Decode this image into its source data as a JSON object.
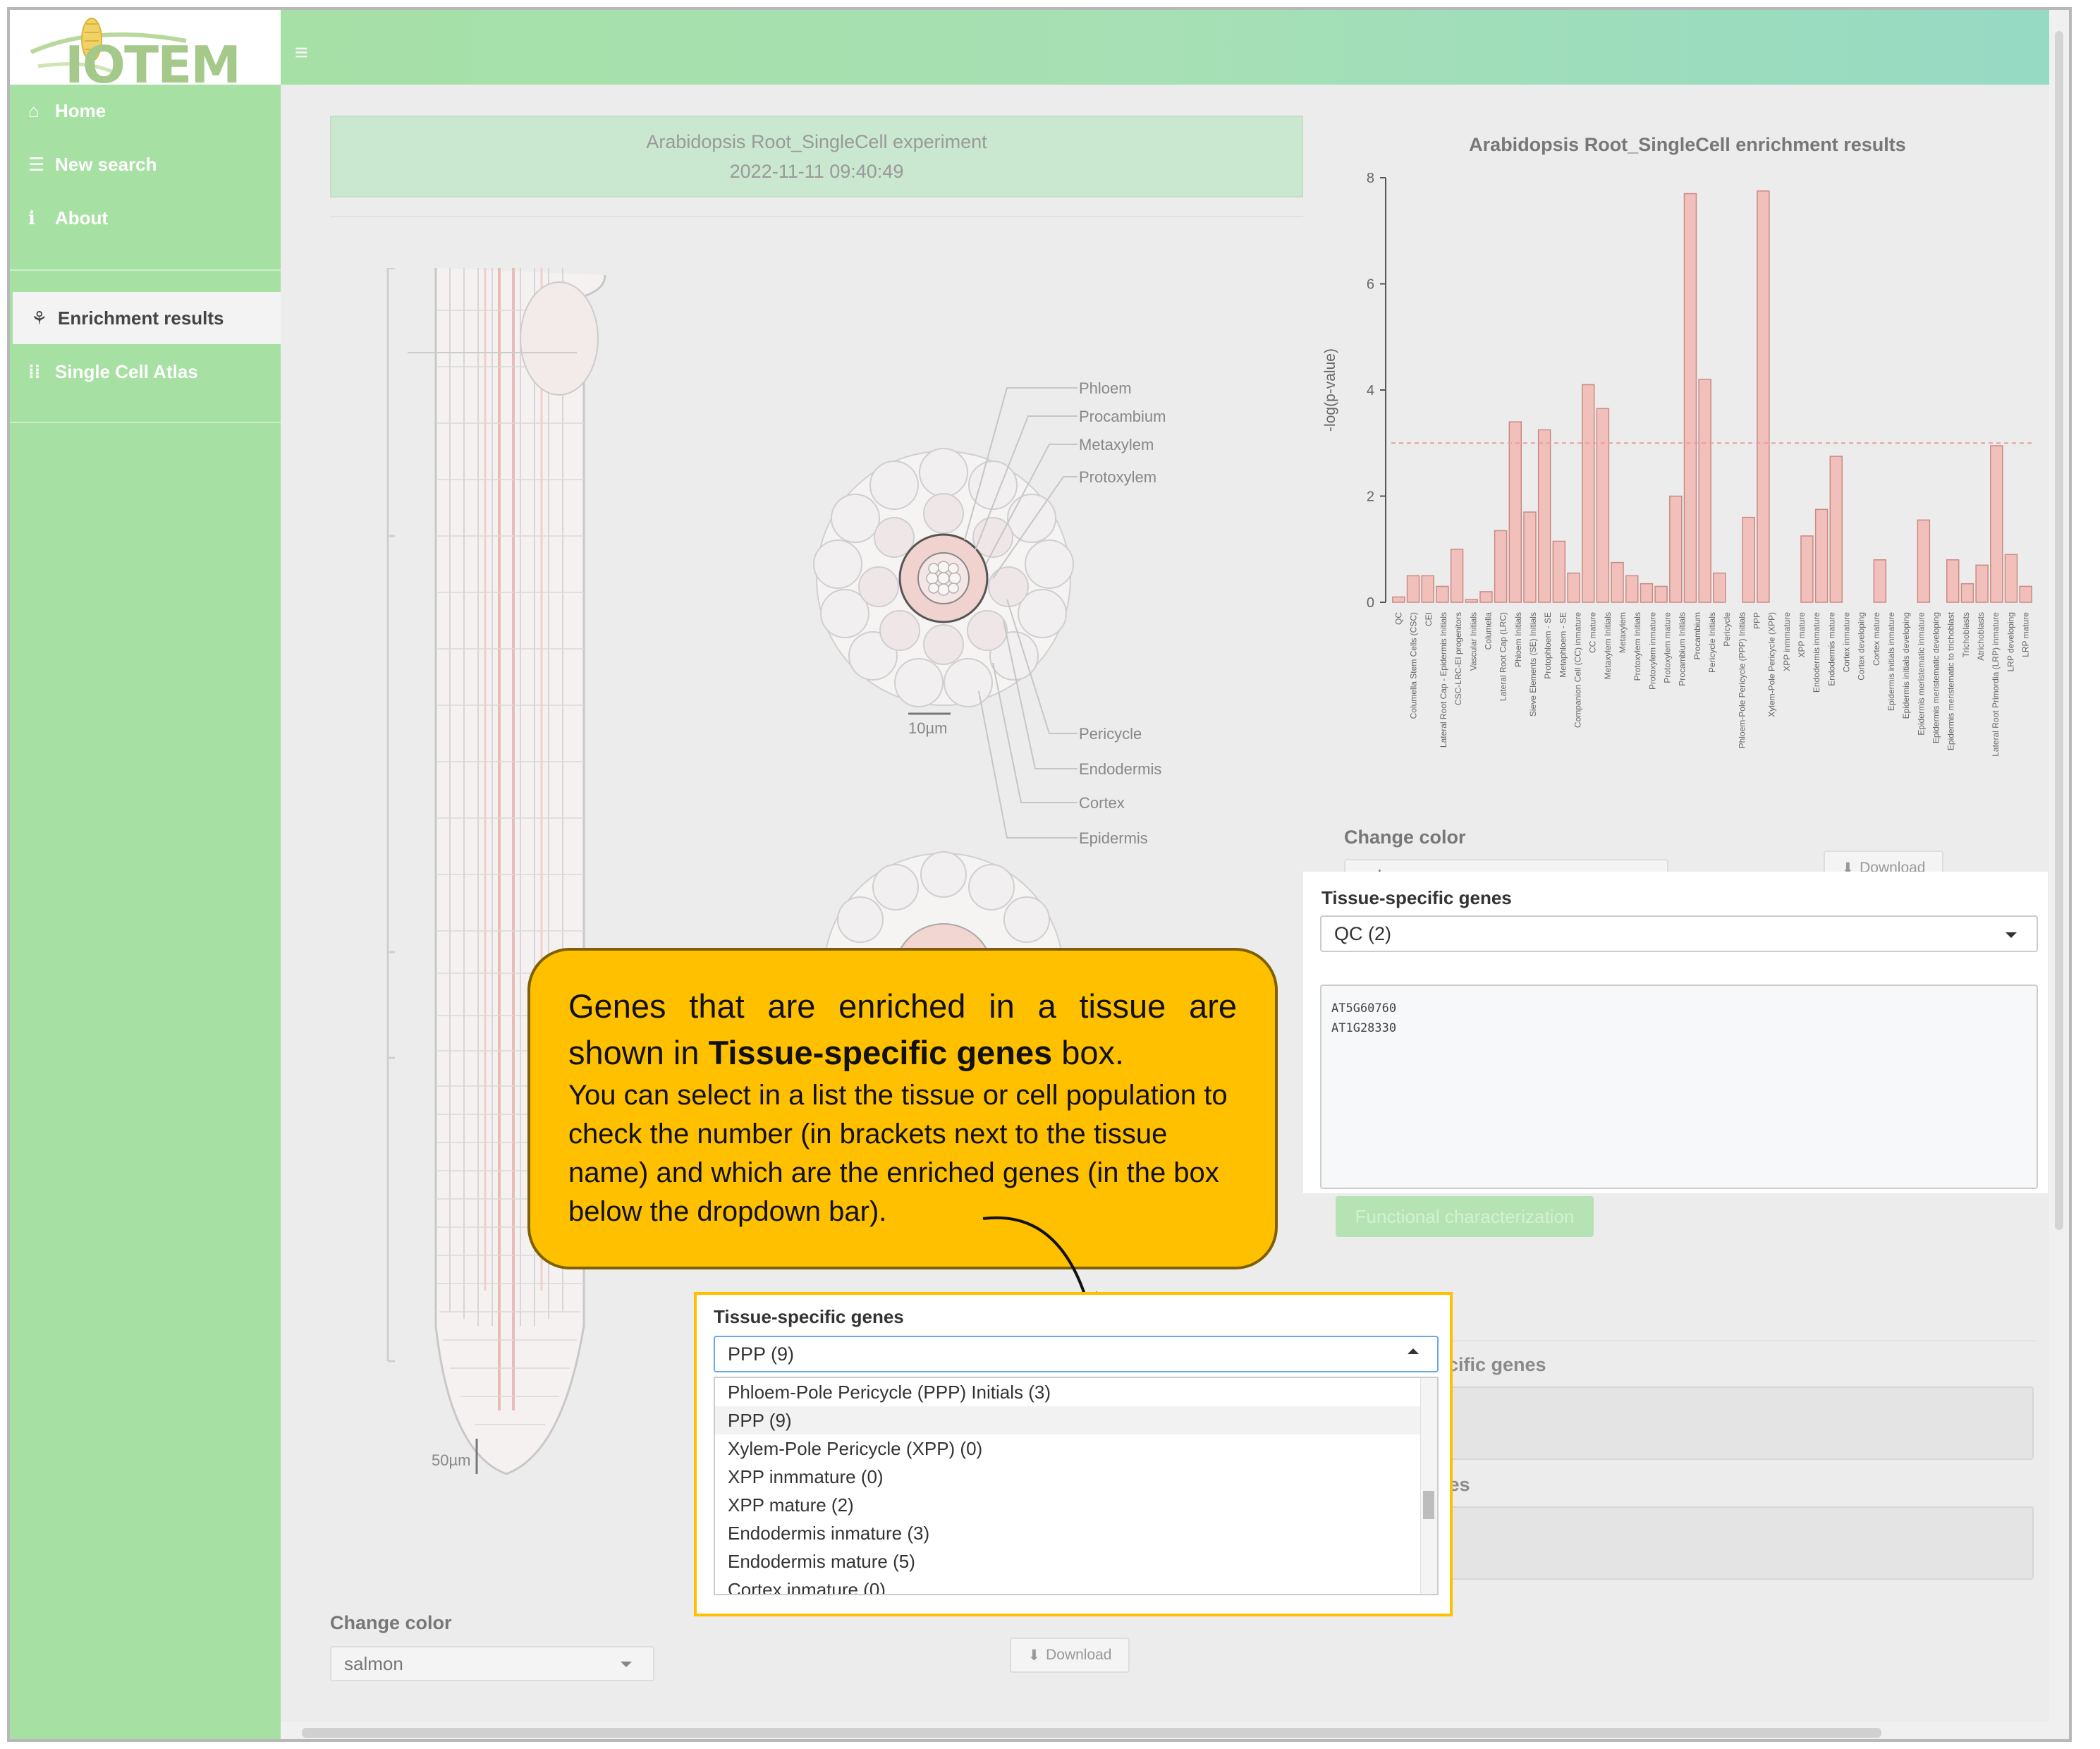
{
  "app": {
    "logo_text": "IOTEM",
    "menu_icon": "hamburger-icon"
  },
  "sidebar": {
    "items": [
      {
        "label": "Home",
        "icon": "home-icon"
      },
      {
        "label": "New search",
        "icon": "database-icon"
      },
      {
        "label": "About",
        "icon": "info-icon"
      },
      {
        "label": "Enrichment results",
        "icon": "seedling-icon"
      },
      {
        "label": "Single Cell Atlas",
        "icon": "grid-dots-icon"
      }
    ]
  },
  "experiment": {
    "name": "Arabidopsis Root_SingleCell experiment",
    "timestamp": "2022-11-11 09:40:49"
  },
  "diagram": {
    "labels_top": [
      "Phloem",
      "Procambium",
      "Metaxylem",
      "Protoxylem"
    ],
    "labels_bottom": [
      "Pericycle",
      "Endodermis",
      "Cortex",
      "Epidermis"
    ],
    "scale_small": "10µm",
    "scale_large": "50µm",
    "highlight_color": "#f2c6bf"
  },
  "left_controls": {
    "change_color_label": "Change color",
    "color_value": "salmon",
    "download_label": "Download"
  },
  "chart_data": {
    "type": "bar",
    "title": "Arabidopsis Root_SingleCell enrichment results",
    "ylabel": "-log(p-value)",
    "xlabel": "",
    "ylim": [
      0,
      8
    ],
    "yticks": [
      0,
      2,
      4,
      6,
      8
    ],
    "threshold": 3,
    "bar_color": "#f2c0bb",
    "bar_border": "#c98a84",
    "threshold_color": "#e8a0a0",
    "categories": [
      "QC",
      "Columella Stem Cells (CSC)",
      "CEI",
      "Lateral Root Cap - Epidermis Initials",
      "CSC-LRC-EI progenitors",
      "Vascular Initials",
      "Columella",
      "Lateral Root Cap (LRC)",
      "Phloem Initials",
      "Sieve Elements (SE) Initials",
      "Protophloem - SE",
      "Metaphloem - SE",
      "Companion Cell (CC) inmature",
      "CC mature",
      "Metaxylem Initials",
      "Metaxylem",
      "Protoxylem Initials",
      "Protoxylem inmature",
      "Protoxylem mature",
      "Procambium Initials",
      "Procambium",
      "Pericycle Initials",
      "Pericycle",
      "Phloem-Pole Pericycle (PPP) Initials",
      "PPP",
      "Xylem-Pole Pericycle (XPP)",
      "XPP inmmature",
      "XPP mature",
      "Endodermis inmature",
      "Endodermis mature",
      "Cortex inmature",
      "Cortex developing",
      "Cortex mature",
      "Epidermis initials inmature",
      "Epidermis initials developing",
      "Epidermis meristematic inmature",
      "Epidermis meristematic developing",
      "Epidermis meristematic to trichoblast",
      "Trichoblasts",
      "Atrichoblasts",
      "Lateral Root Primordia (LRP) inmature",
      "LRP developing",
      "LRP mature"
    ],
    "values": [
      0.1,
      0.5,
      0.5,
      0.3,
      1.0,
      0.05,
      0.2,
      1.35,
      3.4,
      1.7,
      3.25,
      1.15,
      0.55,
      4.1,
      3.65,
      0.75,
      0.5,
      0.35,
      0.3,
      2.0,
      7.7,
      4.2,
      0.55,
      0.0,
      1.6,
      7.75,
      0.0,
      0.0,
      1.25,
      1.75,
      2.75,
      0.0,
      0.0,
      0.8,
      0.0,
      0.0,
      1.55,
      0.0,
      0.8,
      0.35,
      0.7,
      2.95,
      0.9,
      0.3
    ]
  },
  "right_controls": {
    "change_color_label": "Change color",
    "color_value": "salmon",
    "download_label": "Download"
  },
  "tissue_panel": {
    "title": "Tissue-specific genes",
    "selected": "QC (2)",
    "genes": [
      "AT5G60760",
      "AT1G28330"
    ],
    "func_button": "Functional characterization",
    "faded_label_1": "ecific genes",
    "faded_label_2": "nes"
  },
  "callout": {
    "line1": "Genes that are enriched in a tissue are",
    "line2_pre": "shown in ",
    "line2_bold": "Tissue-specific genes",
    "line2_post": " box.",
    "body": "You can select in a list the tissue or cell population to check the number (in brackets next to the tissue name) and which are the enriched genes (in the box below the dropdown bar)."
  },
  "dropdown": {
    "title": "Tissue-specific genes",
    "selected": "PPP (9)",
    "options": [
      "Phloem-Pole Pericycle (PPP) Initials (3)",
      "PPP (9)",
      "Xylem-Pole Pericycle (XPP) (0)",
      "XPP inmmature (0)",
      "XPP mature (2)",
      "Endodermis inmature (3)",
      "Endodermis mature (5)",
      "Cortex inmature (0)"
    ]
  }
}
